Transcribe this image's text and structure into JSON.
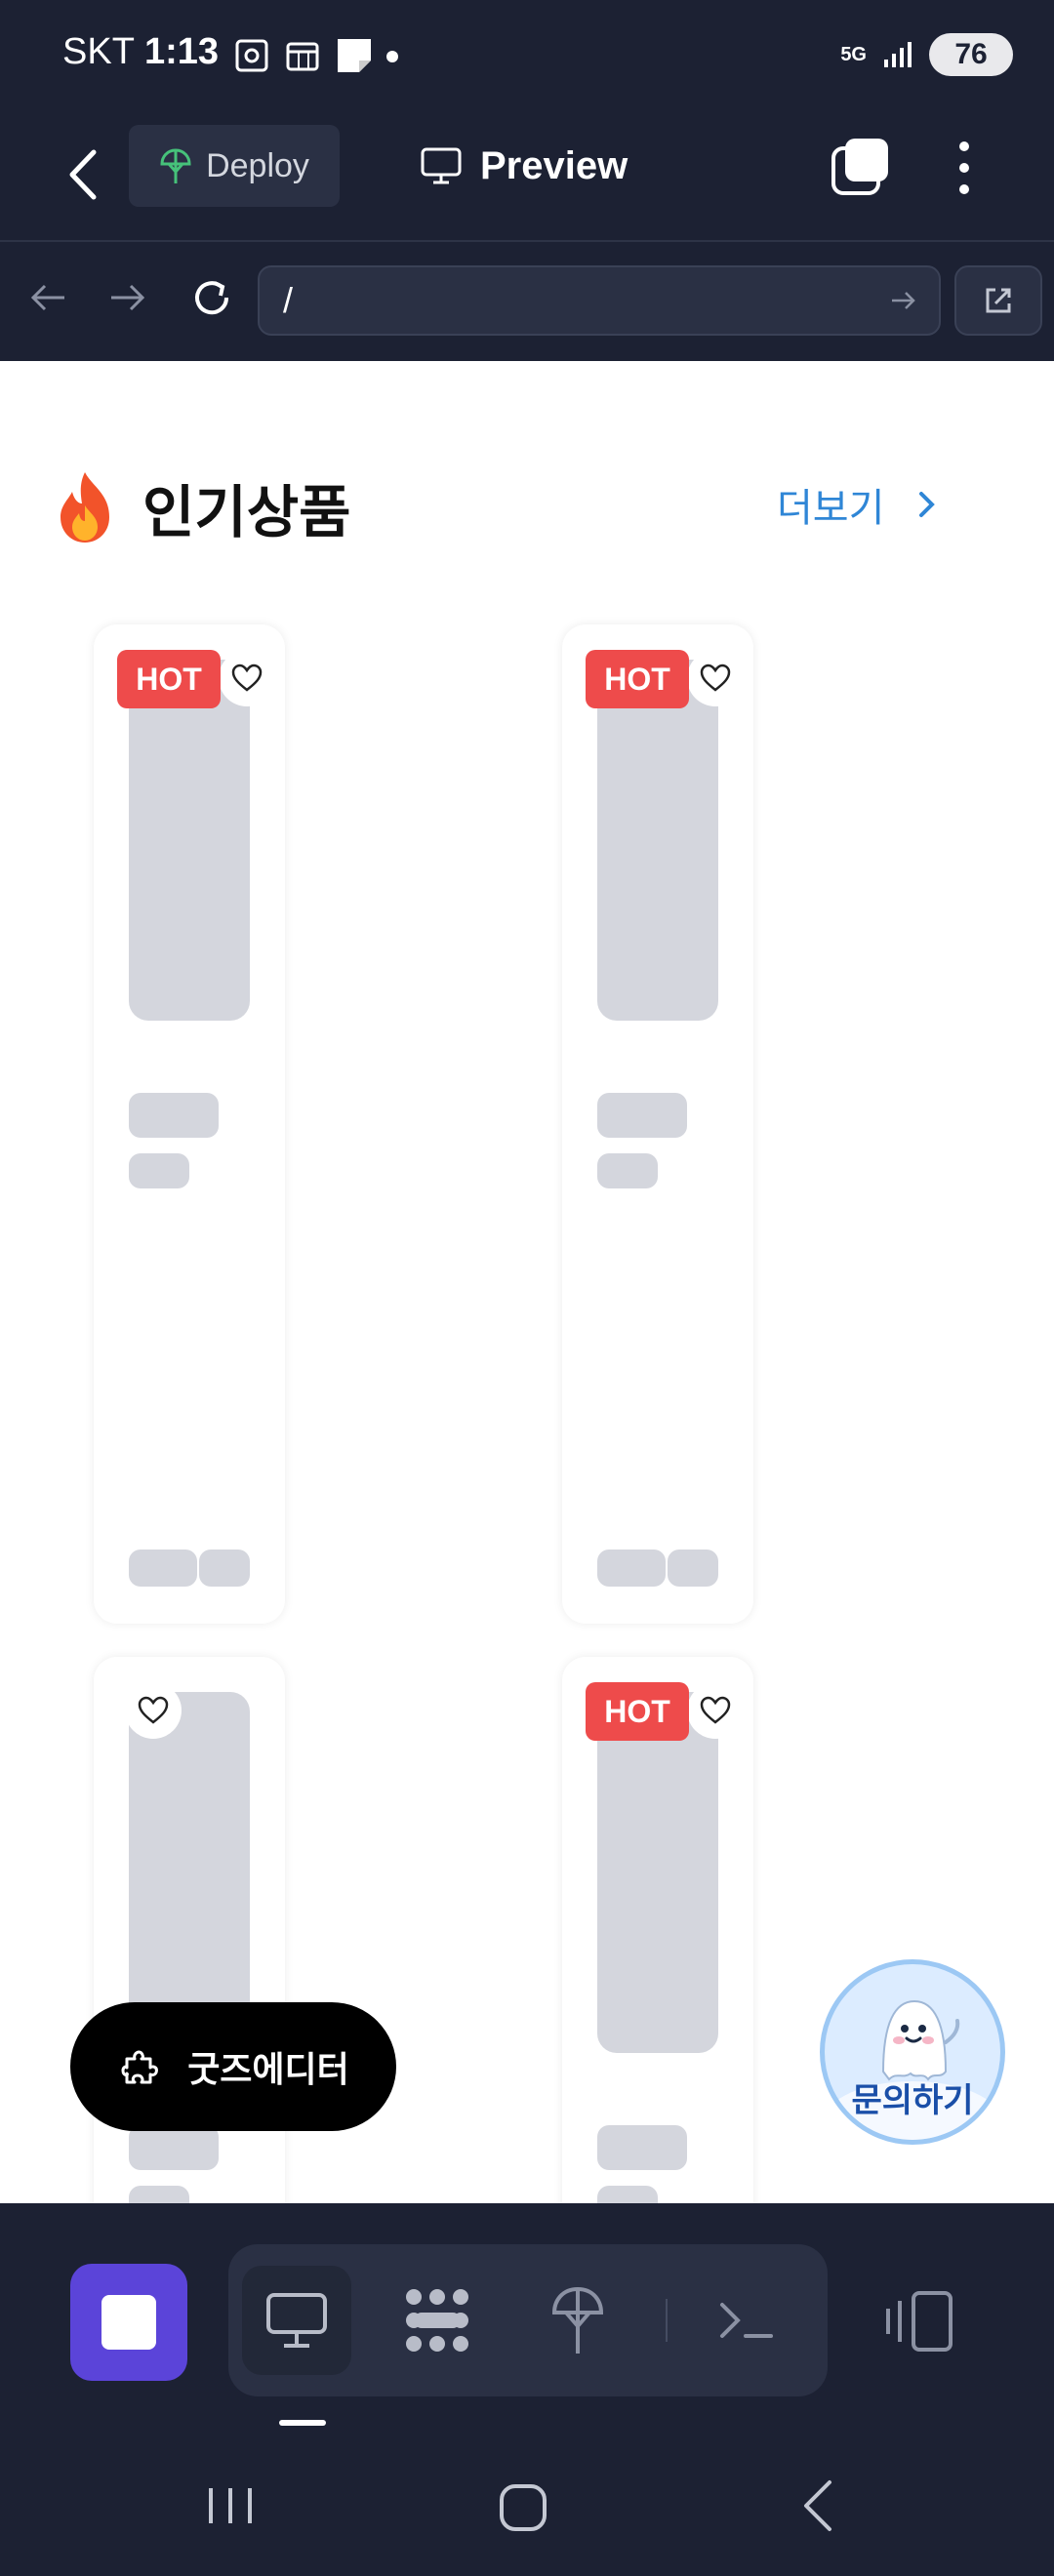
{
  "status_bar": {
    "carrier": "SKT",
    "time": "1:13",
    "network": "5G",
    "battery": "76"
  },
  "app_bar": {
    "deploy_label": "Deploy",
    "preview_label": "Preview"
  },
  "browser": {
    "url": "/"
  },
  "section": {
    "title": "인기상품",
    "more_label": "더보기"
  },
  "cards": [
    {
      "badge": "HOT"
    },
    {
      "badge": "HOT"
    },
    {
      "badge": ""
    },
    {
      "badge": "HOT"
    }
  ],
  "floating": {
    "goods_editor_label": "굿즈에디터",
    "inquiry_label": "문의하기"
  },
  "colors": {
    "accent_purple": "#5b44d9",
    "hot_red": "#ee4b4b",
    "link_blue": "#2f86d6",
    "bg_dark": "#1c2133"
  }
}
